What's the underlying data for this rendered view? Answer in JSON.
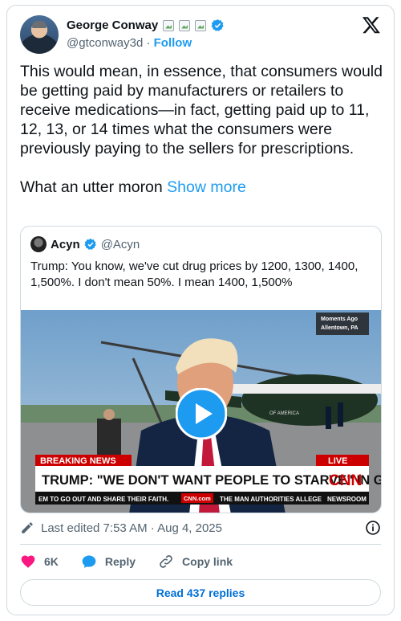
{
  "author": {
    "display_name": "George Conway",
    "handle": "@gtconway3d",
    "separator": "·",
    "follow_label": "Follow"
  },
  "tweet": {
    "paragraph1": "This would mean, in essence, that consumers would be getting paid by manufacturers or retailers to receive medications—in fact, getting paid up to 11, 12, 13, or 14 times what the consumers were previously paying to the sellers for prescriptions.",
    "paragraph2": "What an utter moron",
    "show_more": "Show more"
  },
  "quote": {
    "display_name": "Acyn",
    "handle": "@Acyn",
    "text": "Trump: You know, we've cut drug prices by 1200, 1300, 1400, 1,500%. I don't mean 50%. I mean 1400, 1,500%",
    "video": {
      "bug_line1": "Moments Ago",
      "bug_line2": "Allentown, PA",
      "breaking": "BREAKING NEWS",
      "live": "LIVE",
      "headline": "TRUMP: \"WE DON'T WANT PEOPLE TO STARVE\" IN GAZA",
      "network": "CNN",
      "ticker_left": "EM TO GO OUT AND SHARE THEIR FAITH.",
      "ticker_site": "CNN.com",
      "ticker_right": "THE MAN AUTHORITIES ALLEGE",
      "ticker_section": "NEWSROOM",
      "heli_text": "OF AMERICA"
    }
  },
  "meta": {
    "edited": "Last edited 7:53 AM · Aug 4, 2025"
  },
  "actions": {
    "likes": "6K",
    "reply": "Reply",
    "copy_link": "Copy link",
    "read_replies": "Read 437 replies"
  },
  "colors": {
    "accent": "#1d9bf0",
    "like": "#f91880",
    "cnn_red": "#cc0000"
  }
}
